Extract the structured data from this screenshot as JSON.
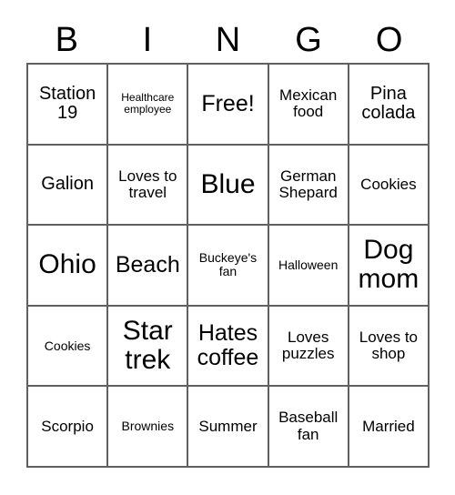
{
  "card": {
    "title": "BINGO",
    "header_letters": [
      "B",
      "I",
      "N",
      "G",
      "O"
    ],
    "grid_size": "5x5",
    "colors": {
      "text": "#000000",
      "grid_line": "#606060",
      "background": "#ffffff"
    },
    "cells": [
      {
        "text": "Station 19",
        "size": "lg"
      },
      {
        "text": "Healthcare employee",
        "size": "xs"
      },
      {
        "text": "Free!",
        "size": "xl"
      },
      {
        "text": "Mexican food",
        "size": "md"
      },
      {
        "text": "Pina colada",
        "size": "lg"
      },
      {
        "text": "Galion",
        "size": "lg"
      },
      {
        "text": "Loves to travel",
        "size": "md"
      },
      {
        "text": "Blue",
        "size": "xxl"
      },
      {
        "text": "German Shepard",
        "size": "md"
      },
      {
        "text": "Cookies",
        "size": "md"
      },
      {
        "text": "Ohio",
        "size": "xxl"
      },
      {
        "text": "Beach",
        "size": "xl"
      },
      {
        "text": "Buckeye's fan",
        "size": "sm"
      },
      {
        "text": "Halloween",
        "size": "sm"
      },
      {
        "text": "Dog mom",
        "size": "xxl"
      },
      {
        "text": "Cookies",
        "size": "sm"
      },
      {
        "text": "Star trek",
        "size": "xxl"
      },
      {
        "text": "Hates coffee",
        "size": "xl"
      },
      {
        "text": "Loves puzzles",
        "size": "md"
      },
      {
        "text": "Loves to shop",
        "size": "md"
      },
      {
        "text": "Scorpio",
        "size": "md"
      },
      {
        "text": "Brownies",
        "size": "sm"
      },
      {
        "text": "Summer",
        "size": "md"
      },
      {
        "text": "Baseball fan",
        "size": "md"
      },
      {
        "text": "Married",
        "size": "md"
      }
    ]
  }
}
